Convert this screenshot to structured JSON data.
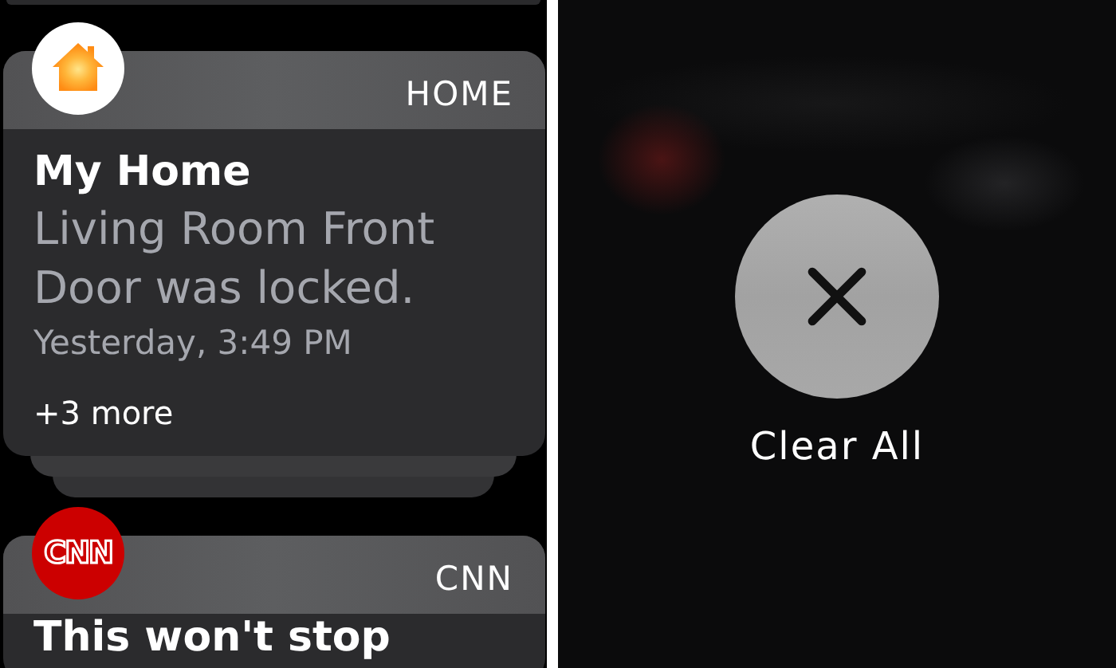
{
  "notifications": [
    {
      "app": "HOME",
      "kind": "home",
      "title": "My Home",
      "body": "Living Room Front Door was locked.",
      "time": "Yesterday, 3:49 PM",
      "more": "+3 more",
      "stacked": true
    },
    {
      "app": "CNN",
      "kind": "cnn",
      "logo_text": "CNN",
      "title": "This won't stop",
      "stacked": false
    }
  ],
  "clear_all": {
    "label": "Clear All"
  }
}
